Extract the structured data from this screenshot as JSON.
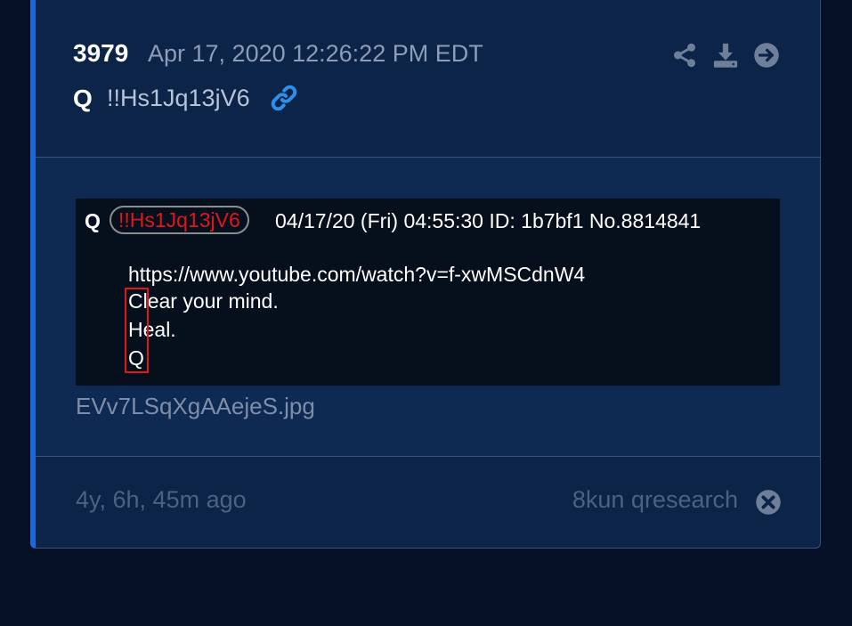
{
  "post": {
    "number": "3979",
    "date": "Apr 17, 2020 12:26:22 PM EDT",
    "author": "Q",
    "tripcode": "!!Hs1Jq13jV6"
  },
  "icons": {
    "link": "link-icon",
    "share": "share-icon",
    "download": "download-icon",
    "open": "arrow-circle-right-icon",
    "close": "close-circle-icon"
  },
  "image": {
    "author": "Q",
    "tripcode": "!!Hs1Jq13jV6",
    "meta": "04/17/20 (Fri) 04:55:30  ID: 1b7bf1  No.8814841",
    "url": "https://www.youtube.com/watch?v=f-xwMSCdnW4",
    "lines": [
      "Clear your mind.",
      "Heal.",
      "Q"
    ],
    "filename": "EVv7LSqXgAAejeS.jpg"
  },
  "footer": {
    "ago": "4y, 6h, 45m ago",
    "source": "8kun qresearch"
  },
  "colors": {
    "background": "#061027",
    "card": "#0c2448",
    "accent": "#1f66d8",
    "link": "#2f8ee8",
    "highlight": "#e2161d"
  }
}
